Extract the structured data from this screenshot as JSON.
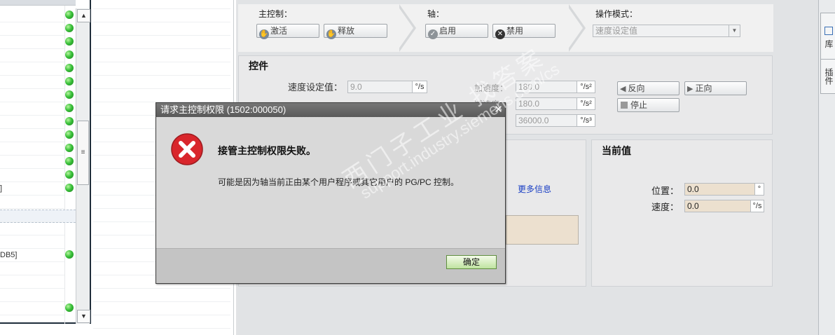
{
  "left_panel": {
    "rows": [
      {
        "text": "",
        "status": "green"
      },
      {
        "text": "",
        "status": "green"
      },
      {
        "text": "",
        "status": "green"
      },
      {
        "text": "",
        "status": "green"
      },
      {
        "text": "",
        "status": "green"
      },
      {
        "text": "",
        "status": "green"
      },
      {
        "text": "",
        "status": "green"
      },
      {
        "text": "",
        "status": "green"
      },
      {
        "text": "",
        "status": "green"
      },
      {
        "text": "",
        "status": "green"
      },
      {
        "text": "",
        "status": "green"
      },
      {
        "text": "",
        "status": "green"
      },
      {
        "text": "",
        "status": "green"
      },
      {
        "text": "]",
        "status": "green"
      },
      {
        "text": "",
        "status": ""
      },
      {
        "text": "",
        "status": ""
      },
      {
        "text": "",
        "status": ""
      },
      {
        "text": "",
        "status": ""
      },
      {
        "text": "DB5]",
        "status": "green"
      },
      {
        "text": "",
        "status": ""
      },
      {
        "text": "",
        "status": ""
      },
      {
        "text": "",
        "status": ""
      },
      {
        "text": "",
        "status": "green"
      }
    ]
  },
  "right_strip": {
    "tabs": [
      "库",
      "插件"
    ]
  },
  "toolbar": {
    "master_label": "主控制：",
    "activate_label": "激活",
    "release_label": "释放",
    "axis_label": "轴：",
    "enable_label": "启用",
    "disable_label": "禁用",
    "mode_label": "操作模式：",
    "mode_value": "速度设定值"
  },
  "control": {
    "title": "控件",
    "speed_setpoint_label": "速度设定值：",
    "speed_setpoint_value": "9.0",
    "speed_unit": "°/s",
    "accel_label": "加速度：",
    "accel_value": "180.0",
    "accel_unit": "°/s²",
    "decel_label": "减速度：",
    "decel_value": "180.0",
    "decel_unit": "°/s²",
    "jerk_value": "36000.0",
    "jerk_unit": "°/s³",
    "reverse_label": "反向",
    "forward_label": "正向",
    "stop_label": "停止"
  },
  "more_info_label": "更多信息",
  "current_values": {
    "title": "当前值",
    "position_label": "位置：",
    "position_value": "0.0",
    "position_unit": "°",
    "velocity_label": "速度：",
    "velocity_value": "0.0",
    "velocity_unit": "°/s"
  },
  "dialog": {
    "title": "请求主控制权限 (1502:000050)",
    "message": "接管主控制权限失败。",
    "detail": "可能是因为轴当前正由某个用户程序或其它用户的 PG/PC 控制。",
    "ok_label": "确定"
  },
  "watermark": {
    "line1": "西门子工业 找答案",
    "line2": "support.industry.siemens.com/cs"
  },
  "colors": {
    "status_green": "#2fb52f",
    "error_red": "#d9262c",
    "ok_button": "#bfe3a0"
  }
}
